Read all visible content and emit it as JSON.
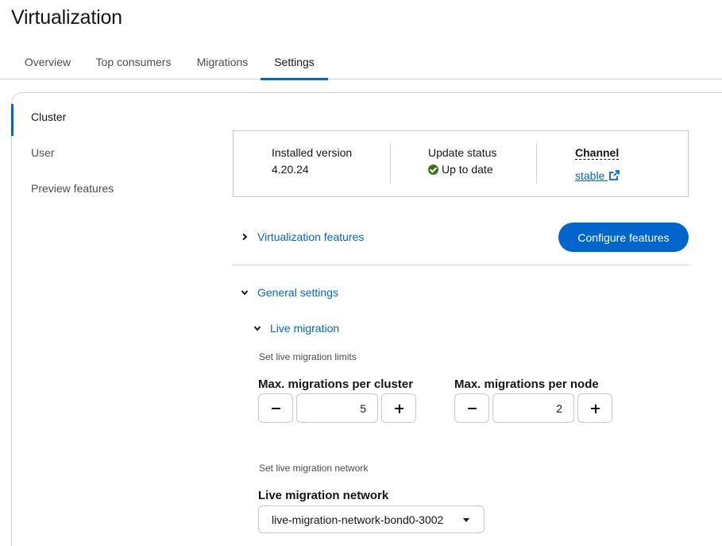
{
  "page": {
    "title": "Virtualization"
  },
  "tabs": [
    {
      "label": "Overview"
    },
    {
      "label": "Top consumers"
    },
    {
      "label": "Migrations"
    },
    {
      "label": "Settings"
    }
  ],
  "sidebar": {
    "items": [
      {
        "label": "Cluster"
      },
      {
        "label": "User"
      },
      {
        "label": "Preview features"
      }
    ]
  },
  "version_card": {
    "installed_label": "Installed version",
    "installed_value": "4.20.24",
    "update_label": "Update status",
    "update_value": "Up to date",
    "channel_label": "Channel",
    "channel_value": "stable"
  },
  "virtualization_features": {
    "label": "Virtualization features",
    "configure_button": "Configure features"
  },
  "general_settings": {
    "label": "General settings",
    "live_migration": {
      "label": "Live migration",
      "limits_help": "Set live migration limits",
      "per_cluster_label": "Max. migrations per cluster",
      "per_cluster_value": "5",
      "per_node_label": "Max. migrations per node",
      "per_node_value": "2",
      "network_help": "Set live migration network",
      "network_label": "Live migration network",
      "network_value": "live-migration-network-bond0-3002"
    }
  },
  "colors": {
    "accent": "#0066cc",
    "success": "#3d7317",
    "border": "#d2d2d2"
  }
}
